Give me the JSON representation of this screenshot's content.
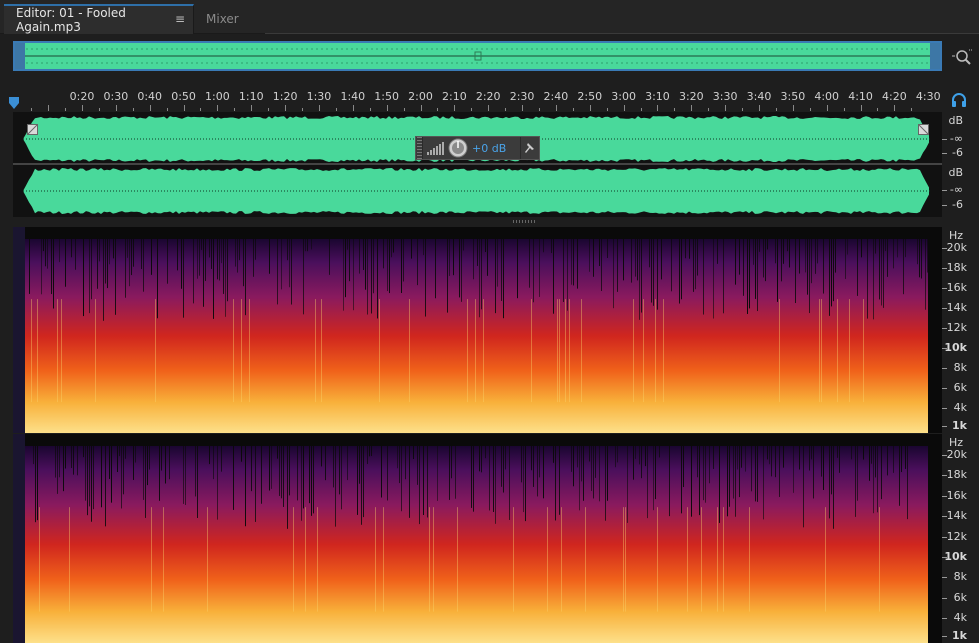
{
  "tabs": {
    "editor_label": "Editor: 01 - Fooled Again.mp3",
    "editor_menu": "≡",
    "mixer_label": "Mixer"
  },
  "timeline": {
    "unit": "hms",
    "ticks": [
      "0:20",
      "0:30",
      "0:40",
      "0:50",
      "1:00",
      "1:10",
      "1:20",
      "1:30",
      "1:40",
      "1:50",
      "2:00",
      "2:10",
      "2:20",
      "2:30",
      "2:40",
      "2:50",
      "3:00",
      "3:10",
      "3:20",
      "3:30",
      "3:40",
      "3:50",
      "4:00",
      "4:10",
      "4:20",
      "4:30"
    ]
  },
  "waveform_scale": {
    "channel1": {
      "unit": "dB",
      "labels": [
        "-∞",
        "-6"
      ]
    },
    "channel2": {
      "unit": "dB",
      "labels": [
        "-∞",
        "-6"
      ]
    }
  },
  "hud": {
    "volume_value": "+0 dB"
  },
  "spectral_scale": {
    "unit": "Hz",
    "labels": [
      "20k",
      "18k",
      "16k",
      "14k",
      "12k",
      "10k",
      "8k",
      "6k",
      "4k",
      "1k"
    ]
  },
  "colors": {
    "waveform": "#49d99b",
    "accent": "#2e6fa8",
    "hud_text": "#4aa3e8"
  }
}
